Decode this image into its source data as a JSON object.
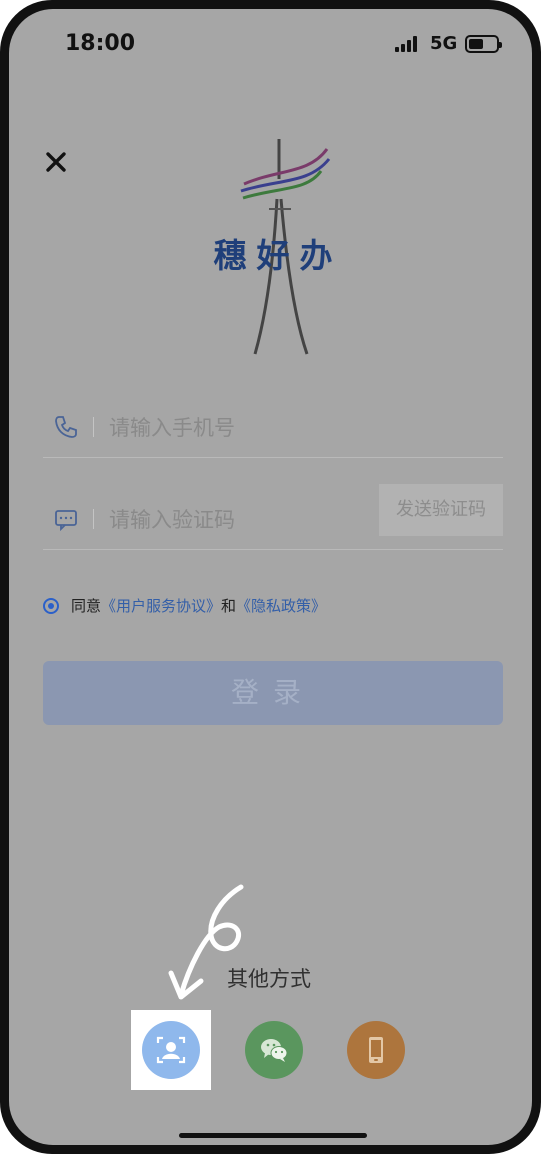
{
  "status_bar": {
    "time": "18:00",
    "network": "5G"
  },
  "app": {
    "logo_text": "穗好办"
  },
  "phone_field": {
    "placeholder": "请输入手机号"
  },
  "code_field": {
    "placeholder": "请输入验证码",
    "send_button_label": "发送验证码"
  },
  "agreement": {
    "prefix": "同意",
    "terms_link": "《用户服务协议》",
    "conjunction": "和",
    "privacy_link": "《隐私政策》"
  },
  "login_button": {
    "label": "登录"
  },
  "other_methods": {
    "label": "其他方式",
    "options": [
      {
        "icon": "face-recognition-icon"
      },
      {
        "icon": "wechat-icon"
      },
      {
        "icon": "phone-login-icon"
      }
    ]
  },
  "annotation": {
    "mark": "6"
  },
  "colors": {
    "overlay_background": "#a6a6a6",
    "brand_blue": "#1f3f7a",
    "link_blue": "#345fa8",
    "face_button": "#8fb8ec",
    "wechat_button": "#5a965e",
    "phone_button": "#ad753d"
  }
}
